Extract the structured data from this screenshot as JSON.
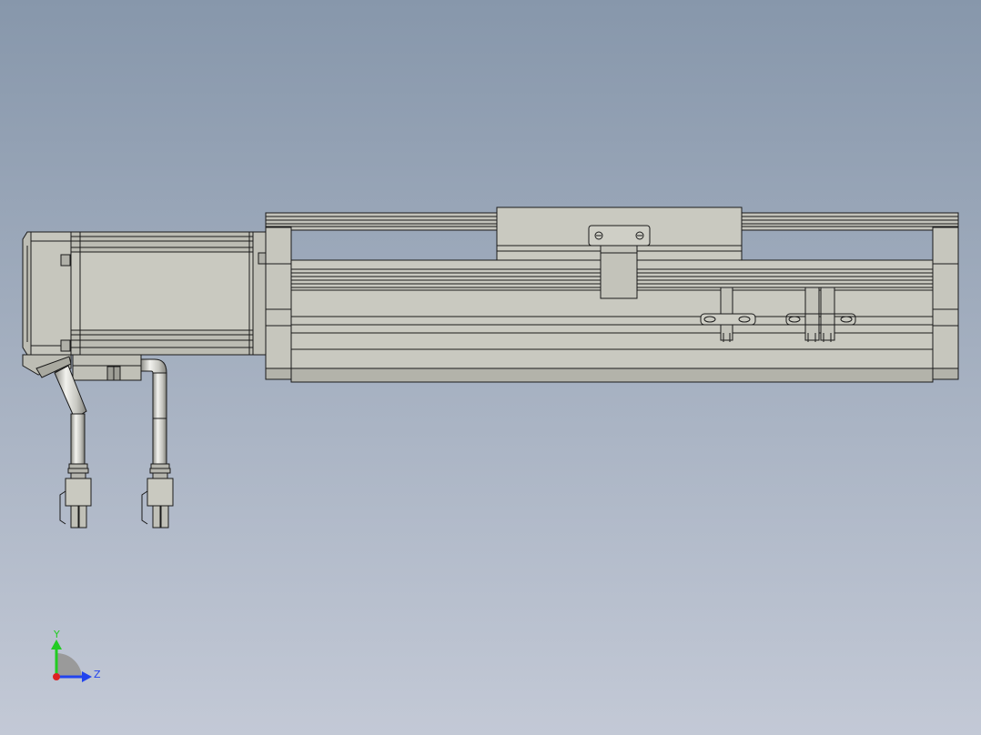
{
  "viewport": {
    "background_top": "#8797ab",
    "background_bottom": "#c3c9d6"
  },
  "model": {
    "fill_color": "#c9c9c0",
    "edge_color": "#1a1a1a",
    "shadow_color": "#a9a9a0"
  },
  "triad": {
    "y_label": "Y",
    "z_label": "Z",
    "y_color": "#22cc22",
    "z_color": "#2244ee",
    "x_color": "#dd2222"
  }
}
